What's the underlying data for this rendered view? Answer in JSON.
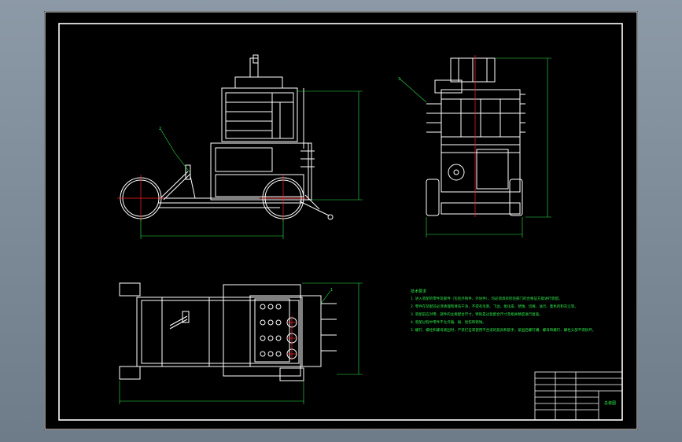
{
  "palette": {
    "background": "#8c99a6",
    "sheet": "#000000",
    "line": "#ffffff",
    "dimension": "#2de84a",
    "centerline": "#ff2020"
  },
  "notes": {
    "title": "技术要求",
    "items": [
      "1. 进入装配的零件及部件（包括外购件、外协件），均必须具有检验部门的合格证方能进行装配。",
      "2. 零件在装配前必须清理和清洗干净，不得有毛刺、飞边、氧化皮、锈蚀、切屑、油污、着色剂和灰尘等。",
      "3. 装配前应对零、部件的主要配合尺寸，特别是过盈配合尺寸及相关精度进行复查。",
      "4. 装配过程中零件不允许磕、碰、划伤和锈蚀。",
      "5. 螺钉、螺栓和螺母紧固时，严禁打击或使用不合适的旋具和扳手，紧固后螺钉槽、螺母和螺钉、螺栓头部不得损坏。"
    ]
  },
  "part_labels": [
    "1",
    "2",
    "3"
  ],
  "title_block": {
    "name": "总装图"
  }
}
